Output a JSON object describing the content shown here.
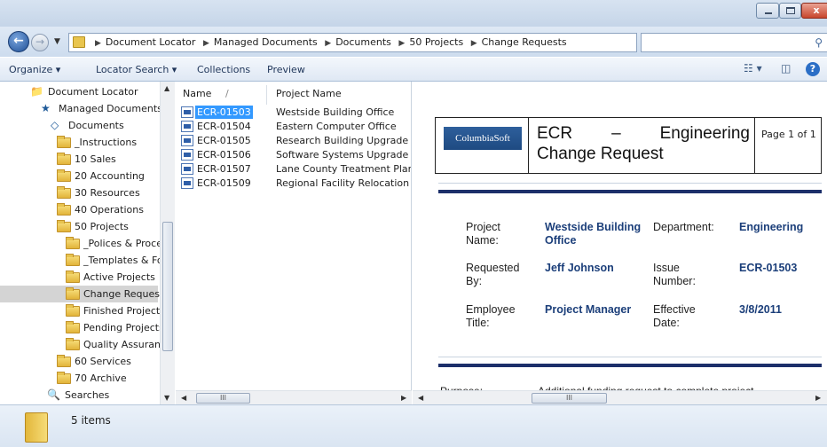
{
  "window": {
    "close_glyph": "x"
  },
  "address": {
    "crumbs": [
      "Document Locator",
      "Managed Documents",
      "Documents",
      "50 Projects",
      "Change Requests"
    ],
    "search_placeholder": ""
  },
  "toolbar": {
    "organize": "Organize ▾",
    "locator_search": "Locator Search ▾",
    "collections": "Collections",
    "preview": "Preview",
    "help": "?"
  },
  "tree": {
    "items": [
      {
        "label": "Document Locator",
        "indent": 0
      },
      {
        "label": "Managed Documents",
        "indent": 1
      },
      {
        "label": "Documents",
        "indent": 2
      },
      {
        "label": "_Instructions",
        "indent": 3
      },
      {
        "label": "10 Sales",
        "indent": 3
      },
      {
        "label": "20 Accounting",
        "indent": 3
      },
      {
        "label": "30 Resources",
        "indent": 3
      },
      {
        "label": "40 Operations",
        "indent": 3
      },
      {
        "label": "50 Projects",
        "indent": 3
      },
      {
        "label": "_Polices & Procedu",
        "indent": 4
      },
      {
        "label": "_Templates & Form",
        "indent": 4
      },
      {
        "label": "Active Projects",
        "indent": 4
      },
      {
        "label": "Change Requests",
        "indent": 4,
        "selected": true
      },
      {
        "label": "Finished Projects",
        "indent": 4
      },
      {
        "label": "Pending Projects",
        "indent": 4
      },
      {
        "label": "Quality Assurance",
        "indent": 4
      },
      {
        "label": "60 Services",
        "indent": 3
      },
      {
        "label": "70 Archive",
        "indent": 3
      },
      {
        "label": "Searches",
        "indent": 2
      }
    ]
  },
  "files": {
    "columns": {
      "name": "Name",
      "sort_glyph": "/",
      "project": "Project Name"
    },
    "rows": [
      {
        "name": "ECR-01503",
        "project": "Westside Building Office",
        "selected": true
      },
      {
        "name": "ECR-01504",
        "project": "Eastern Computer Office"
      },
      {
        "name": "ECR-01505",
        "project": "Research Building Upgrade"
      },
      {
        "name": "ECR-01506",
        "project": "Software Systems Upgrade"
      },
      {
        "name": "ECR-01507",
        "project": "Lane County Treatment Plant"
      },
      {
        "name": "ECR-01509",
        "project": "Regional Facility Relocation"
      }
    ],
    "hscroll_glyph": "III"
  },
  "preview": {
    "logo": "ColumbiaSoft",
    "title_line1": "ECR – Engineering",
    "title_line2": "Change Request",
    "page_of": "Page 1 of 1",
    "fields": {
      "project_name_label": "Project Name:",
      "project_name_value": "Westside Building Office",
      "department_label": "Department:",
      "department_value": "Engineering",
      "requested_by_label": "Requested By:",
      "requested_by_value": "Jeff Johnson",
      "issue_number_label": "Issue Number:",
      "issue_number_value": "ECR-01503",
      "employee_title_label": "Employee Title:",
      "employee_title_value": "Project Manager",
      "effective_date_label": "Effective Date:",
      "effective_date_value": "3/8/2011"
    },
    "purpose_label": "Purpose:",
    "purpose_value": "Additional funding request to complete project",
    "hscroll_glyph": "III"
  },
  "status": {
    "items_count": "5 items"
  },
  "colors": {
    "selection": "#3399ff",
    "doc_value": "#1c3f7a",
    "rule": "#1c2f6a"
  }
}
